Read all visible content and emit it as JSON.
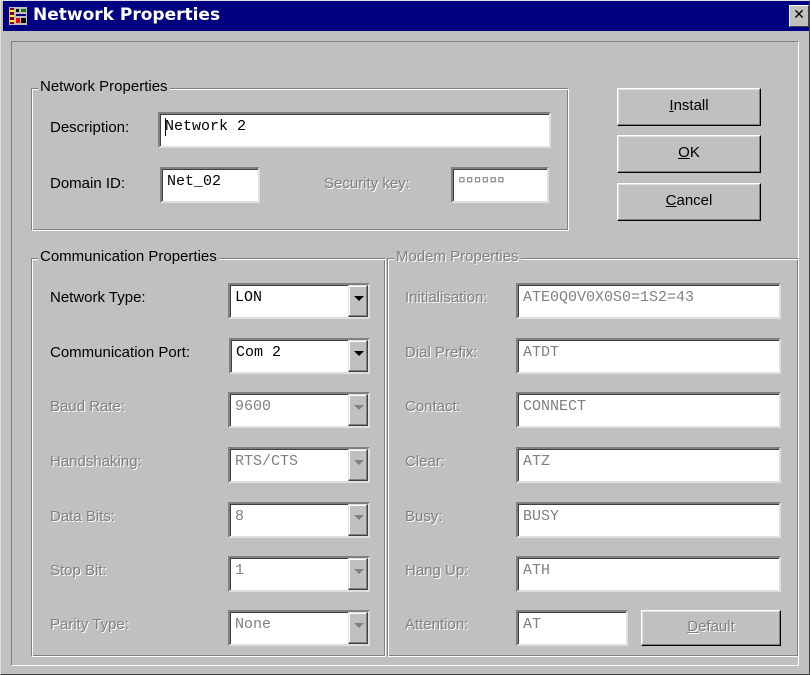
{
  "window": {
    "title": "Network Properties",
    "close_glyph": "✕"
  },
  "network_group": {
    "legend": "Network Properties",
    "description_label": "Description:",
    "description_value": "Network 2",
    "domain_label": "Domain ID:",
    "domain_value": "Net_02",
    "security_label": "Security key:",
    "security_value": "¤¤¤¤¤¤"
  },
  "buttons": {
    "install": {
      "pre": "",
      "key": "I",
      "post": "nstall"
    },
    "ok": {
      "pre": "",
      "key": "O",
      "post": "K"
    },
    "cancel": {
      "pre": "",
      "key": "C",
      "post": "ancel"
    }
  },
  "comm_group": {
    "legend": "Communication Properties",
    "network_type_label": "Network Type:",
    "network_type_value": "LON",
    "comm_port_label": "Communication Port:",
    "comm_port_value": "Com 2",
    "baud_label": "Baud Rate:",
    "baud_value": "9600",
    "handshake_label": "Handshaking:",
    "handshake_value": "RTS/CTS",
    "databits_label": "Data Bits:",
    "databits_value": "8",
    "stopbit_label": "Stop Bit:",
    "stopbit_value": "1",
    "parity_label": "Parity Type:",
    "parity_value": "None"
  },
  "modem_group": {
    "legend": "Modem Properties",
    "init_label": "Initialisation:",
    "init_value": "ATE0Q0V0X0S0=1S2=43",
    "dial_label": "Dial Prefix:",
    "dial_value": "ATDT",
    "contact_label": "Contact:",
    "contact_value": "CONNECT",
    "clear_label": "Clear:",
    "clear_value": "ATZ",
    "busy_label": "Busy:",
    "busy_value": "BUSY",
    "hangup_label": "Hang Up:",
    "hangup_value": "ATH",
    "attention_label": "Attention:",
    "attention_value": "AT",
    "default_button": {
      "pre": "",
      "key": "D",
      "post": "efault"
    }
  }
}
